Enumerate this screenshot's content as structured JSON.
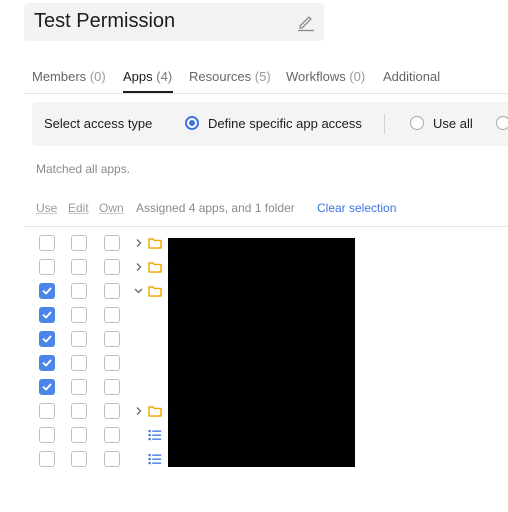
{
  "header": {
    "title": "Test Permission"
  },
  "tabs": [
    {
      "label": "Members",
      "count": "(0)"
    },
    {
      "label": "Apps",
      "count": "(4)"
    },
    {
      "label": "Resources",
      "count": "(5)"
    },
    {
      "label": "Workflows",
      "count": "(0)"
    },
    {
      "label": "Additional",
      "count": ""
    }
  ],
  "active_tab": "Apps",
  "access": {
    "label": "Select access type",
    "options": [
      "Define specific app access",
      "Use all"
    ],
    "selected": "Define specific app access"
  },
  "matched_text": "Matched all apps.",
  "columns": {
    "use": "Use",
    "edit": "Edit",
    "own": "Own"
  },
  "assigned_text": "Assigned 4 apps, and 1 folder",
  "clear_label": "Clear selection",
  "rows": [
    {
      "use": false,
      "edit": false,
      "own": false,
      "chevron": "right",
      "icon": "folder-icon"
    },
    {
      "use": false,
      "edit": false,
      "own": false,
      "chevron": "right",
      "icon": "folder-icon"
    },
    {
      "use": true,
      "edit": false,
      "own": false,
      "chevron": "down",
      "icon": "folder-icon"
    },
    {
      "use": true,
      "edit": false,
      "own": false,
      "chevron": "",
      "icon": ""
    },
    {
      "use": true,
      "edit": false,
      "own": false,
      "chevron": "",
      "icon": ""
    },
    {
      "use": true,
      "edit": false,
      "own": false,
      "chevron": "",
      "icon": ""
    },
    {
      "use": true,
      "edit": false,
      "own": false,
      "chevron": "",
      "icon": ""
    },
    {
      "use": false,
      "edit": false,
      "own": false,
      "chevron": "right",
      "icon": "folder-icon"
    },
    {
      "use": false,
      "edit": false,
      "own": false,
      "chevron": "",
      "icon": "list-icon"
    },
    {
      "use": false,
      "edit": false,
      "own": false,
      "chevron": "",
      "icon": "list-icon"
    }
  ],
  "colors": {
    "accent": "#4a86e8",
    "folder": "#f0a500",
    "list": "#3d73e0",
    "redaction": "#000000"
  }
}
